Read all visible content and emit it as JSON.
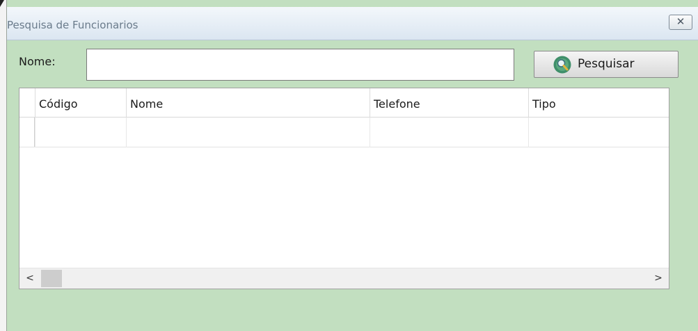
{
  "window": {
    "title": "Pesquisa de Funcionarios",
    "close_glyph": "✕"
  },
  "search": {
    "label": "Nome:",
    "value": "",
    "placeholder": "",
    "button_label": "Pesquisar",
    "button_icon": "magnifier-icon"
  },
  "grid": {
    "columns": [
      "Código",
      "Nome",
      "Telefone",
      "Tipo"
    ],
    "rows": [
      [
        "",
        "",
        "",
        ""
      ]
    ]
  },
  "scrollbar": {
    "left_glyph": "<",
    "right_glyph": ">"
  },
  "colors": {
    "window_background": "#c2dfc0",
    "titlebar": "#dbe6f1",
    "icon_green": "#3f8f6a",
    "icon_handle": "#e2b53c"
  }
}
